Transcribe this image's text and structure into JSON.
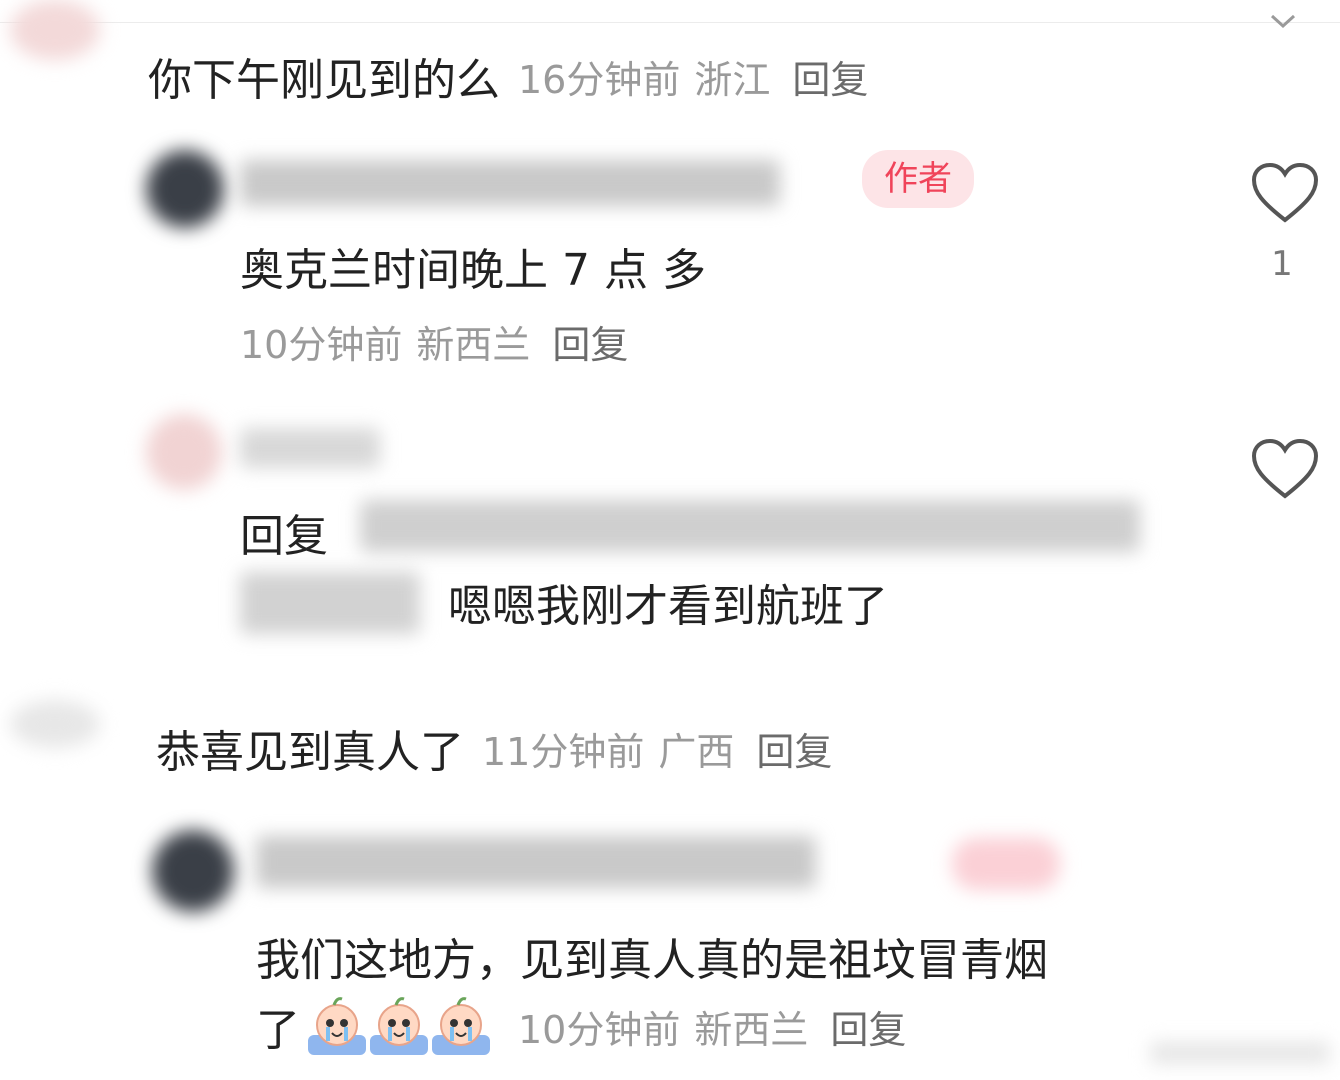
{
  "comments": [
    {
      "text": "你下午刚见到的么",
      "time": "16分钟前",
      "location": "浙江",
      "reply_label": "回复"
    },
    {
      "badge": "作者",
      "text": "奥克兰时间晚上 7 点 多",
      "time": "10分钟前",
      "location": "新西兰",
      "reply_label": "回复",
      "like_count": "1"
    },
    {
      "reply_prefix": "回复",
      "text": "嗯嗯我刚才看到航班了"
    },
    {
      "text": "恭喜见到真人了",
      "time": "11分钟前",
      "location": "广西",
      "reply_label": "回复"
    },
    {
      "text_line1": "我们这地方，见到真人真的是祖坟冒青烟",
      "text_line2": "了",
      "time": "10分钟前",
      "location": "新西兰",
      "reply_label": "回复"
    }
  ],
  "icons": {
    "like": "heart-outline-icon",
    "emoji": "crying-peach-emoji-icon"
  },
  "colors": {
    "badge_bg": "#fde4e7",
    "badge_text": "#f0445a",
    "meta_text": "#9a9a9a"
  }
}
